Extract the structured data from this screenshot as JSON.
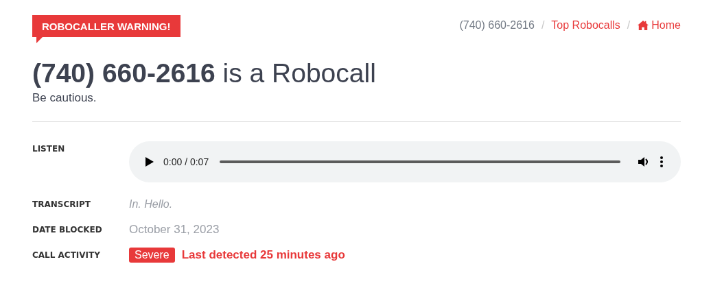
{
  "badge": "ROBOCALLER WARNING!",
  "breadcrumb_separator": "/",
  "breadcrumbs": [
    {
      "label": "(740) 660-2616",
      "kind": "current"
    },
    {
      "label": "Top Robocalls",
      "kind": "link"
    },
    {
      "label": "Home",
      "kind": "home"
    }
  ],
  "heading": {
    "number": "(740) 660-2616",
    "rest": "is a Robocall"
  },
  "subtitle": "Be cautious.",
  "details": [
    {
      "label": "LISTEN",
      "kind": "audio",
      "time": "0:00 / 0:07"
    },
    {
      "label": "TRANSCRIPT",
      "kind": "transcript",
      "value": "In. Hello."
    },
    {
      "label": "DATE BLOCKED",
      "kind": "date",
      "value": "October 31, 2023"
    },
    {
      "label": "CALL ACTIVITY",
      "kind": "activity",
      "severity": "Severe",
      "value": "Last detected 25 minutes ago"
    }
  ]
}
